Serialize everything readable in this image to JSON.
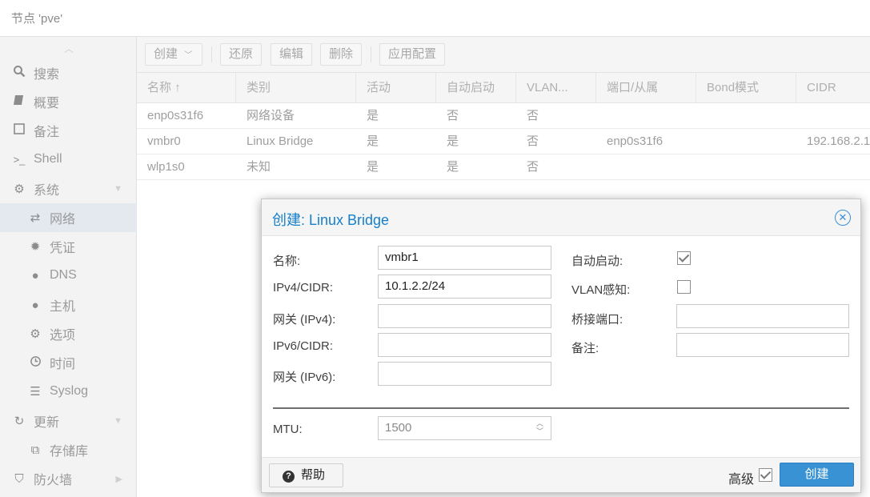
{
  "header": {
    "title": "节点 'pve'"
  },
  "sidebar": {
    "items": [
      {
        "label": "搜索",
        "icon": "search-icon"
      },
      {
        "label": "概要",
        "icon": "book-icon"
      },
      {
        "label": "备注",
        "icon": "note-icon"
      },
      {
        "label": "Shell",
        "icon": "terminal-icon"
      },
      {
        "label": "系统",
        "icon": "gears-icon"
      },
      {
        "label": "网络",
        "icon": "exchange-icon"
      },
      {
        "label": "凭证",
        "icon": "certificate-icon"
      },
      {
        "label": "DNS",
        "icon": "globe-icon"
      },
      {
        "label": "主机",
        "icon": "globe-icon"
      },
      {
        "label": "选项",
        "icon": "gear-icon"
      },
      {
        "label": "时间",
        "icon": "clock-icon"
      },
      {
        "label": "Syslog",
        "icon": "list-icon"
      },
      {
        "label": "更新",
        "icon": "refresh-icon"
      },
      {
        "label": "存储库",
        "icon": "copy-icon"
      },
      {
        "label": "防火墙",
        "icon": "shield-icon"
      }
    ]
  },
  "toolbar": {
    "create": "创建",
    "revert": "还原",
    "edit": "编辑",
    "delete": "删除",
    "apply": "应用配置"
  },
  "grid": {
    "columns": [
      "名称 ↑",
      "类别",
      "活动",
      "自动启动",
      "VLAN...",
      "端口/从属",
      "Bond模式",
      "CIDR"
    ],
    "rows": [
      [
        "enp0s31f6",
        "网络设备",
        "是",
        "否",
        "否",
        "",
        "",
        ""
      ],
      [
        "vmbr0",
        "Linux Bridge",
        "是",
        "是",
        "否",
        "enp0s31f6",
        "",
        "192.168.2.1"
      ],
      [
        "wlp1s0",
        "未知",
        "是",
        "是",
        "否",
        "",
        "",
        ""
      ]
    ]
  },
  "dialog": {
    "title": "创建: Linux Bridge",
    "labels": {
      "name": "名称:",
      "ipv4": "IPv4/CIDR:",
      "gw4": "网关 (IPv4):",
      "ipv6": "IPv6/CIDR:",
      "gw6": "网关 (IPv6):",
      "autostart": "自动启动:",
      "vlan": "VLAN感知:",
      "ports": "桥接端口:",
      "comment": "备注:",
      "mtu": "MTU:"
    },
    "values": {
      "name": "vmbr1",
      "ipv4": "10.1.2.2/24",
      "gw4": "",
      "ipv6": "",
      "gw6": "",
      "ports": "",
      "comment": "",
      "mtu": "1500"
    },
    "checkboxes": {
      "autostart": true,
      "vlan": false,
      "advanced": true
    },
    "footer": {
      "help": "帮助",
      "advanced": "高级",
      "create": "创建"
    }
  },
  "colors": {
    "accent": "#157fcc",
    "primary_button": "#3892d4"
  }
}
